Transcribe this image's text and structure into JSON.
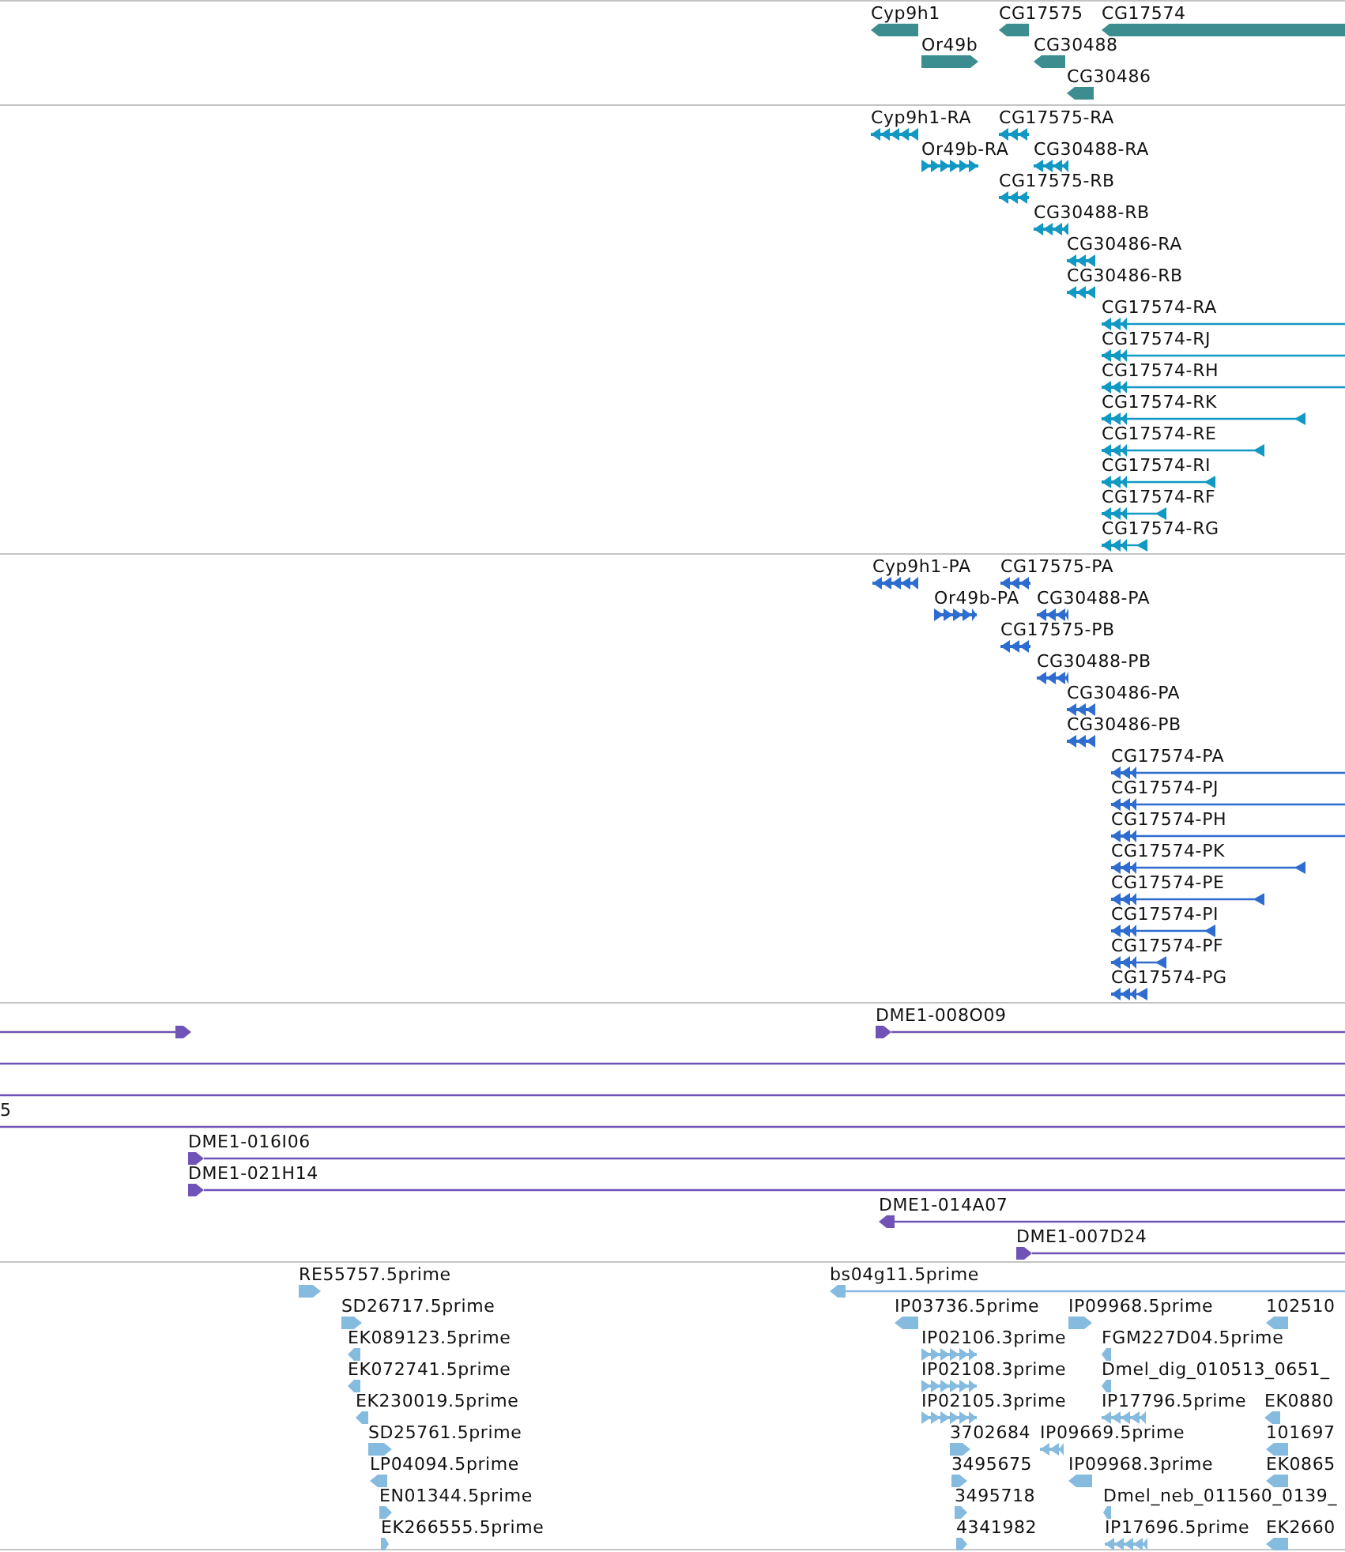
{
  "tracks": [
    {
      "color": "#3b8d90",
      "features": [
        {
          "label": "Cyp9h1",
          "kind": "block",
          "reverse": true
        },
        {
          "label": "CG17575",
          "kind": "block",
          "reverse": true
        },
        {
          "label": "CG17574",
          "kind": "block",
          "reverse": true
        },
        {
          "label": "Or49b",
          "kind": "block",
          "reverse": false
        },
        {
          "label": "CG30488",
          "kind": "block",
          "reverse": true
        },
        {
          "label": "CG30486",
          "kind": "block",
          "reverse": true
        }
      ]
    },
    {
      "color": "#1199c4",
      "features": [
        {
          "label": "Cyp9h1-RA",
          "kind": "exons",
          "reverse": true
        },
        {
          "label": "CG17575-RA",
          "kind": "exons",
          "reverse": true
        },
        {
          "label": "Or49b-RA",
          "kind": "exons",
          "reverse": false
        },
        {
          "label": "CG30488-RA",
          "kind": "exons",
          "reverse": true
        },
        {
          "label": "CG17575-RB",
          "kind": "exons",
          "reverse": true
        },
        {
          "label": "CG30488-RB",
          "kind": "exons",
          "reverse": true
        },
        {
          "label": "CG30486-RA",
          "kind": "exons",
          "reverse": true
        },
        {
          "label": "CG30486-RB",
          "kind": "exons",
          "reverse": true
        },
        {
          "label": "CG17574-RA",
          "kind": "spliced",
          "reverse": true
        },
        {
          "label": "CG17574-RJ",
          "kind": "spliced",
          "reverse": true
        },
        {
          "label": "CG17574-RH",
          "kind": "spliced",
          "reverse": true
        },
        {
          "label": "CG17574-RK",
          "kind": "spliced",
          "reverse": true
        },
        {
          "label": "CG17574-RE",
          "kind": "spliced",
          "reverse": true
        },
        {
          "label": "CG17574-RI",
          "kind": "spliced",
          "reverse": true
        },
        {
          "label": "CG17574-RF",
          "kind": "spliced",
          "reverse": true
        },
        {
          "label": "CG17574-RG",
          "kind": "spliced",
          "reverse": true
        }
      ]
    },
    {
      "color": "#2e6dcf",
      "features": [
        {
          "label": "Cyp9h1-PA",
          "kind": "exons",
          "reverse": true
        },
        {
          "label": "CG17575-PA",
          "kind": "exons",
          "reverse": true
        },
        {
          "label": "Or49b-PA",
          "kind": "exons",
          "reverse": false
        },
        {
          "label": "CG30488-PA",
          "kind": "exons",
          "reverse": true
        },
        {
          "label": "CG17575-PB",
          "kind": "exons",
          "reverse": true
        },
        {
          "label": "CG30488-PB",
          "kind": "exons",
          "reverse": true
        },
        {
          "label": "CG30486-PA",
          "kind": "exons",
          "reverse": true
        },
        {
          "label": "CG30486-PB",
          "kind": "exons",
          "reverse": true
        },
        {
          "label": "CG17574-PA",
          "kind": "spliced",
          "reverse": true
        },
        {
          "label": "CG17574-PJ",
          "kind": "spliced",
          "reverse": true
        },
        {
          "label": "CG17574-PH",
          "kind": "spliced",
          "reverse": true
        },
        {
          "label": "CG17574-PK",
          "kind": "spliced",
          "reverse": true
        },
        {
          "label": "CG17574-PE",
          "kind": "spliced",
          "reverse": true
        },
        {
          "label": "CG17574-PI",
          "kind": "spliced",
          "reverse": true
        },
        {
          "label": "CG17574-PF",
          "kind": "spliced",
          "reverse": true
        },
        {
          "label": "CG17574-PG",
          "kind": "spliced",
          "reverse": true
        }
      ]
    },
    {
      "color": "#6f53b6",
      "features": [
        {
          "kind": "tail",
          "reverse": false
        },
        {
          "label": "DME1-008O09",
          "kind": "clone",
          "reverse": false
        },
        {
          "kind": "line"
        },
        {
          "kind": "line"
        },
        {
          "label": "5",
          "kind": "line"
        },
        {
          "label": "DME1-016I06",
          "kind": "clone",
          "reverse": false
        },
        {
          "label": "DME1-021H14",
          "kind": "clone",
          "reverse": false
        },
        {
          "label": "DME1-014A07",
          "kind": "clone",
          "reverse": true
        },
        {
          "label": "DME1-007D24",
          "kind": "clone",
          "reverse": false
        }
      ]
    },
    {
      "color": "#86bbe0",
      "features": [
        {
          "label": "RE55757.5prime",
          "kind": "block",
          "reverse": false
        },
        {
          "label": "bs04g11.5prime",
          "kind": "clone",
          "reverse": true
        },
        {
          "label": "SD26717.5prime",
          "kind": "block",
          "reverse": false
        },
        {
          "label": "IP03736.5prime",
          "kind": "block",
          "reverse": true
        },
        {
          "label": "IP09968.5prime",
          "kind": "block",
          "reverse": false
        },
        {
          "label": "102510",
          "kind": "block",
          "reverse": true
        },
        {
          "label": "EK089123.5prime",
          "kind": "block",
          "reverse": true
        },
        {
          "label": "IP02106.3prime",
          "kind": "exons",
          "reverse": false
        },
        {
          "label": "FGM227D04.5prime",
          "kind": "block",
          "reverse": true
        },
        {
          "label": "EK072741.5prime",
          "kind": "block",
          "reverse": true
        },
        {
          "label": "IP02108.3prime",
          "kind": "exons",
          "reverse": false
        },
        {
          "label": "Dmel_dig_010513_0651_",
          "kind": "block",
          "reverse": true
        },
        {
          "label": "EK230019.5prime",
          "kind": "block",
          "reverse": true
        },
        {
          "label": "IP02105.3prime",
          "kind": "exons",
          "reverse": false
        },
        {
          "label": "IP17796.5prime",
          "kind": "exons",
          "reverse": true
        },
        {
          "label": "EK0880",
          "kind": "block",
          "reverse": true
        },
        {
          "label": "SD25761.5prime",
          "kind": "block",
          "reverse": false
        },
        {
          "label": "3702684",
          "kind": "block",
          "reverse": false
        },
        {
          "label": "IP09669.5prime",
          "kind": "exons",
          "reverse": true
        },
        {
          "label": "101697",
          "kind": "block",
          "reverse": true
        },
        {
          "label": "LP04094.5prime",
          "kind": "block",
          "reverse": true
        },
        {
          "label": "3495675",
          "kind": "block",
          "reverse": false
        },
        {
          "label": "IP09968.3prime",
          "kind": "block",
          "reverse": true
        },
        {
          "label": "EK0865",
          "kind": "block",
          "reverse": true
        },
        {
          "label": "EN01344.5prime",
          "kind": "block",
          "reverse": false
        },
        {
          "label": "3495718",
          "kind": "block",
          "reverse": false
        },
        {
          "label": "Dmel_neb_011560_0139_",
          "kind": "block",
          "reverse": true
        },
        {
          "label": "EK266555.5prime",
          "kind": "block",
          "reverse": false
        },
        {
          "label": "4341982",
          "kind": "block",
          "reverse": false
        },
        {
          "label": "IP17696.5prime",
          "kind": "exons",
          "reverse": true
        },
        {
          "label": "EK2660",
          "kind": "block",
          "reverse": true
        }
      ]
    }
  ]
}
